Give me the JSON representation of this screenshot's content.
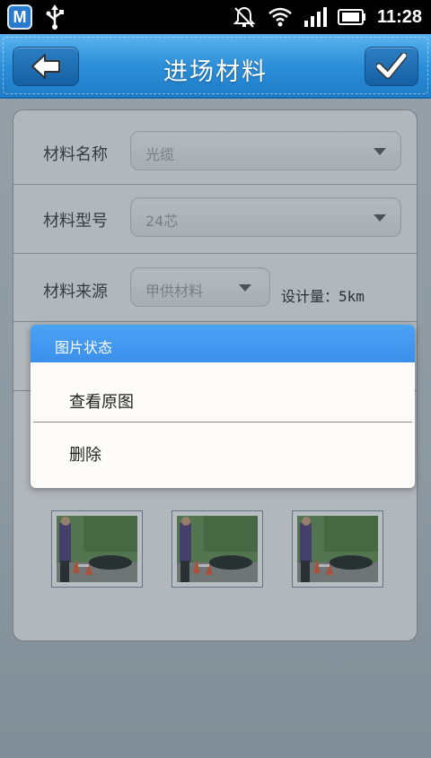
{
  "status_bar": {
    "app_icon_letter": "M",
    "time": "11:28"
  },
  "title_bar": {
    "title": "进场材料"
  },
  "form": {
    "rows": [
      {
        "label": "材料名称",
        "value": "光缆"
      },
      {
        "label": "材料型号",
        "value": "24芯"
      },
      {
        "label": "材料来源",
        "value": "甲供材料"
      }
    ],
    "design_quantity": "设计量：5km"
  },
  "photos": {
    "count": 3
  },
  "dialog": {
    "title": "图片状态",
    "items": [
      "查看原图",
      "删除"
    ]
  },
  "colors": {
    "accent": "#3b90ea",
    "title_bar": "#2d8fd9"
  }
}
